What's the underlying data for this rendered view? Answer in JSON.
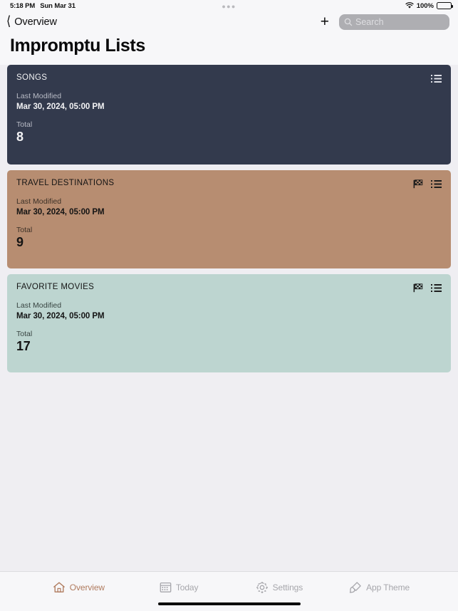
{
  "status_bar": {
    "time": "5:18 PM",
    "date": "Sun Mar 31",
    "center_icon": "more-dots-icon",
    "wifi_icon": "wifi-icon",
    "battery_percent": "100%",
    "battery_icon": "battery-full-icon"
  },
  "nav": {
    "back_icon": "chevron-left-icon",
    "back_label": "Overview",
    "add_icon": "plus-icon",
    "add_label": "+",
    "search_icon": "search-icon",
    "search_placeholder": "Search",
    "search_value": ""
  },
  "header": {
    "title": "Impromptu Lists"
  },
  "cards": [
    {
      "title": "SONGS",
      "theme": "theme-dark",
      "color": "#333a4d",
      "modified_label": "Last Modified",
      "modified_value": "Mar 30, 2024, 05:00 PM",
      "total_label": "Total",
      "total_value": "8",
      "has_flag": false,
      "flag_icon": "checkered-flag-icon",
      "list_icon": "list-bullet-icon"
    },
    {
      "title": "TRAVEL DESTINATIONS",
      "theme": "theme-tan",
      "color": "#b78d71",
      "modified_label": "Last Modified",
      "modified_value": "Mar 30, 2024, 05:00 PM",
      "total_label": "Total",
      "total_value": "9",
      "has_flag": true,
      "flag_icon": "checkered-flag-icon",
      "list_icon": "list-bullet-icon"
    },
    {
      "title": "FAVORITE MOVIES",
      "theme": "theme-mint",
      "color": "#bdd5d0",
      "modified_label": "Last Modified",
      "modified_value": "Mar 30, 2024, 05:00 PM",
      "total_label": "Total",
      "total_value": "17",
      "has_flag": true,
      "flag_icon": "checkered-flag-icon",
      "list_icon": "list-bullet-icon"
    }
  ],
  "tabs": [
    {
      "label": "Overview",
      "icon": "home-icon",
      "active": true
    },
    {
      "label": "Today",
      "icon": "calendar-icon",
      "active": false
    },
    {
      "label": "Settings",
      "icon": "gear-icon",
      "active": false
    },
    {
      "label": "App Theme",
      "icon": "paintbrush-icon",
      "active": false
    }
  ],
  "theme": {
    "background": "#efeef2",
    "chrome": "#f7f7f9",
    "accent": "#b07b5e",
    "inactive": "#a6a6ab"
  }
}
